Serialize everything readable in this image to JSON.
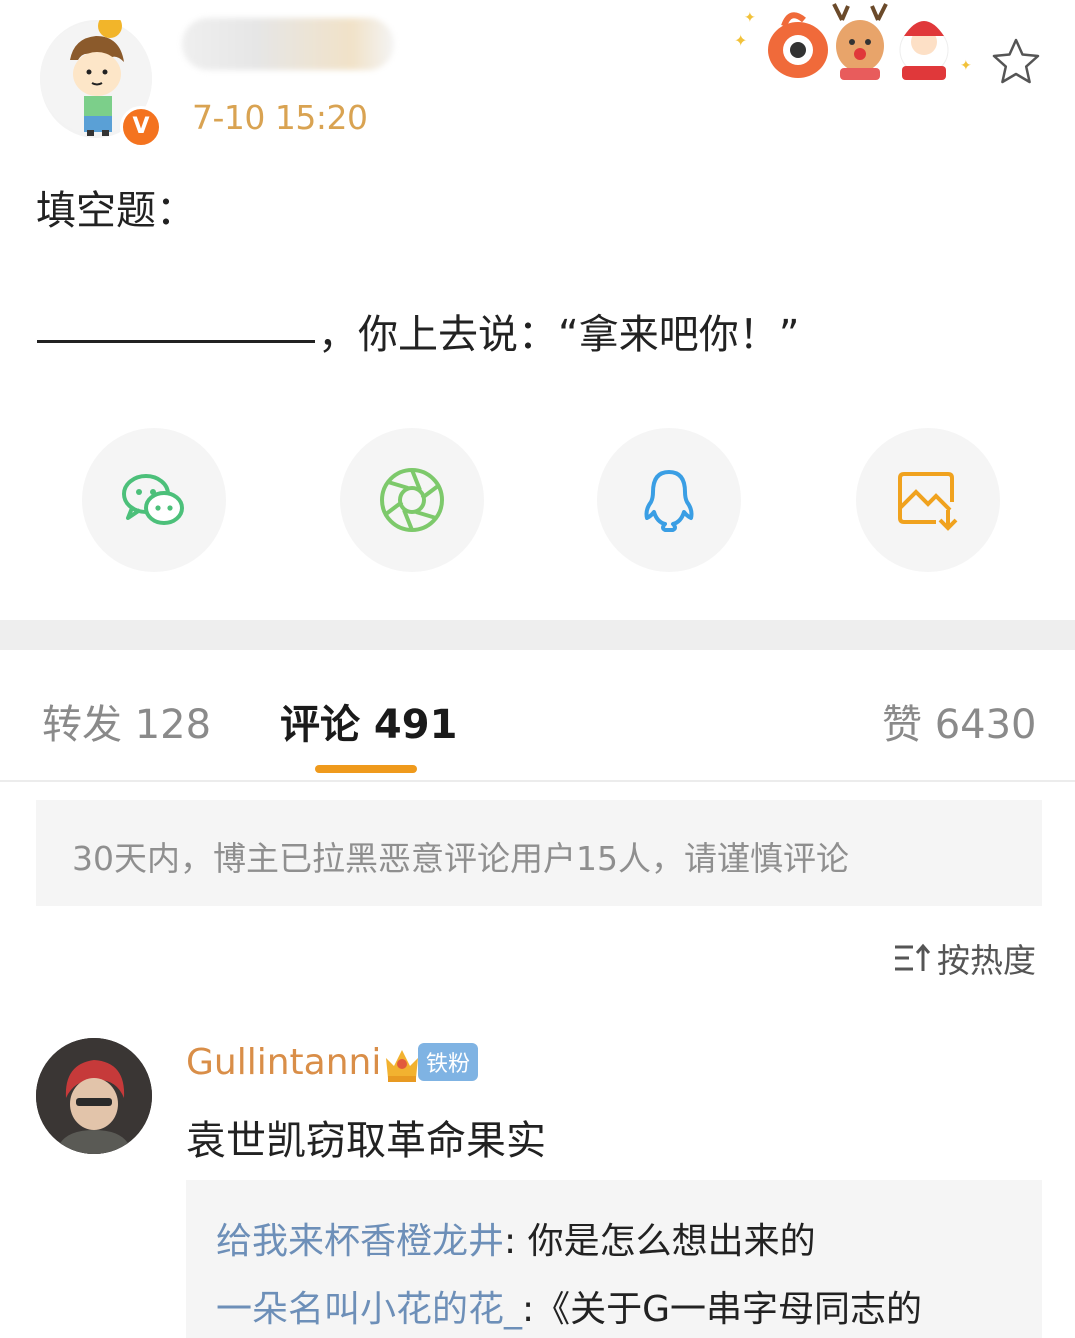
{
  "post": {
    "time": "7-10 15:20",
    "line1": "填空题：",
    "line2": "，你上去说：“拿来吧你！”"
  },
  "share_buttons": [
    {
      "icon": "wechat-icon",
      "color": "#4cc07a"
    },
    {
      "icon": "moments-icon",
      "color": "#7dc96b"
    },
    {
      "icon": "qq-icon",
      "color": "#3a9ee4"
    },
    {
      "icon": "save-image-icon",
      "color": "#f0a21e"
    }
  ],
  "tabs": {
    "repost": "转发 128",
    "comment": "评论 491",
    "like": "赞 6430"
  },
  "notice": "30天内，博主已拉黑恶意评论用户15人，请谨慎评论",
  "sort_label": "按热度",
  "comment": {
    "username": "Gullintanni",
    "badge": "铁粉",
    "text": "袁世凯窃取革命果实",
    "replies": [
      {
        "name": "给我来杯香橙龙井",
        "text": ": 你是怎么想出来的"
      },
      {
        "name": "一朵名叫小花的花_",
        "text": ":《关于G一串字母同志的"
      }
    ]
  },
  "colors": {
    "accent": "#ef9a1c",
    "time": "#d9a352",
    "reply_name": "#6d8fb8"
  }
}
